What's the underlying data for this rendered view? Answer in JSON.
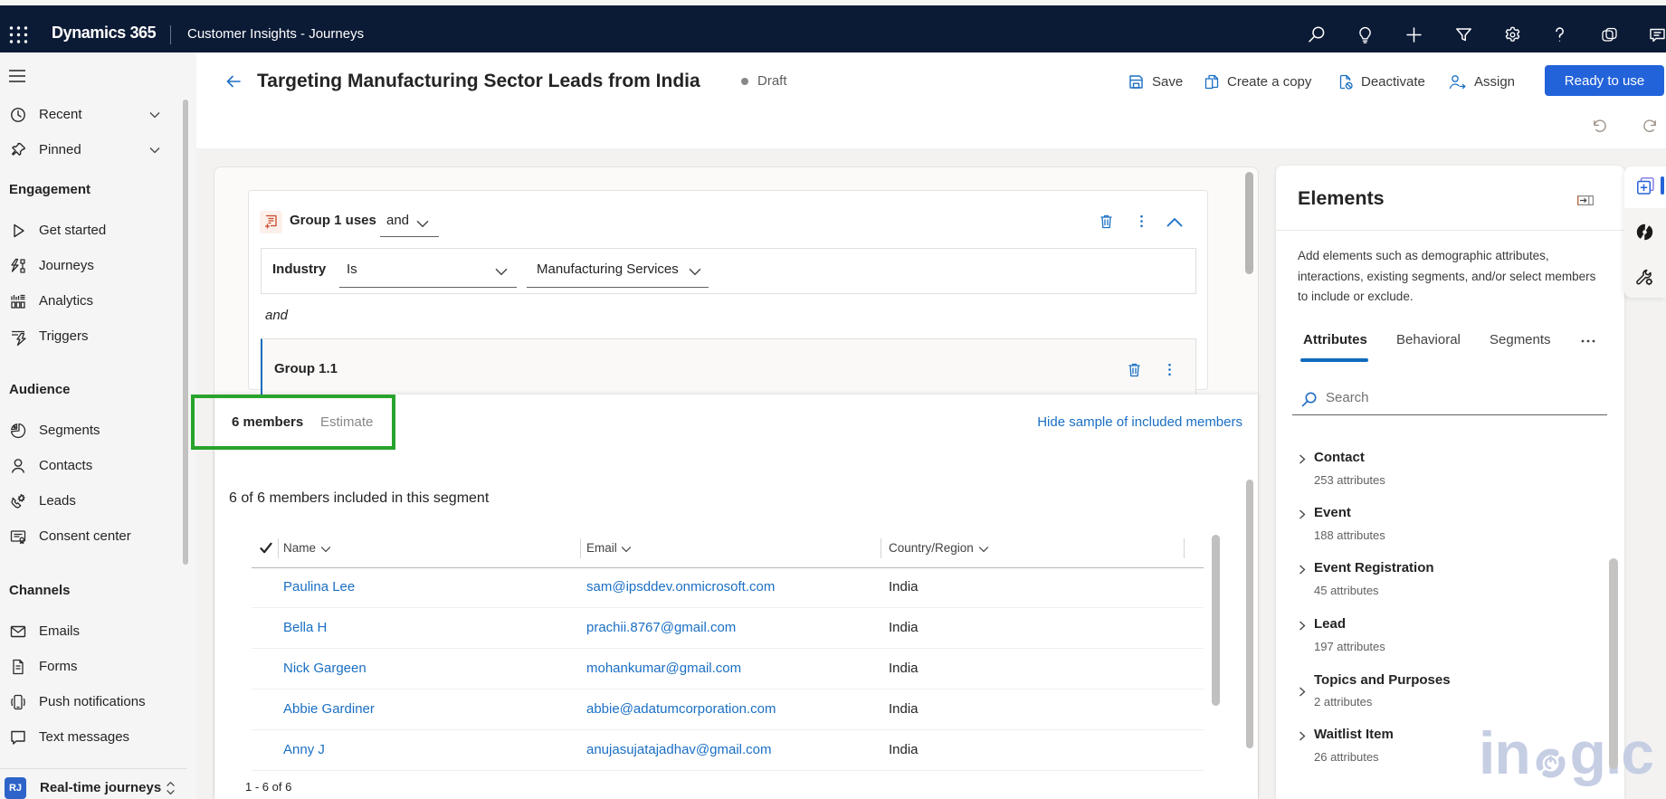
{
  "topbar": {
    "app_name": "Dynamics 365",
    "section_name": "Customer Insights - Journeys"
  },
  "header": {
    "title": "Targeting Manufacturing Sector Leads from India",
    "status": "Draft",
    "save_label": "Save",
    "create_copy_label": "Create a copy",
    "deactivate_label": "Deactivate",
    "assign_label": "Assign",
    "primary_label": "Ready to use"
  },
  "sidebar": {
    "recent_label": "Recent",
    "pinned_label": "Pinned",
    "sections": [
      {
        "title": "Engagement",
        "items": [
          {
            "label": "Get started"
          },
          {
            "label": "Journeys"
          },
          {
            "label": "Analytics"
          },
          {
            "label": "Triggers"
          }
        ]
      },
      {
        "title": "Audience",
        "items": [
          {
            "label": "Segments"
          },
          {
            "label": "Contacts"
          },
          {
            "label": "Leads"
          },
          {
            "label": "Consent center"
          }
        ]
      },
      {
        "title": "Channels",
        "items": [
          {
            "label": "Emails"
          },
          {
            "label": "Forms"
          },
          {
            "label": "Push notifications"
          },
          {
            "label": "Text messages"
          }
        ]
      }
    ],
    "area_badge": "RJ",
    "area_name": "Real-time journeys"
  },
  "builder": {
    "group_label": "Group 1 uses",
    "group_operator": "and",
    "condition_attribute": "Industry",
    "condition_operator": "Is",
    "condition_value": "Manufacturing Services",
    "connector": "and",
    "subgroup_label": "Group 1.1"
  },
  "members": {
    "members_tab": "6 members",
    "estimate_tab": "Estimate",
    "hide_link": "Hide sample of included members",
    "summary": "6 of 6 members included in this segment",
    "columns": [
      "Name",
      "Email",
      "Country/Region"
    ],
    "rows": [
      {
        "name": "Paulina Lee",
        "email": "sam@ipsddev.onmicrosoft.com",
        "country": "India"
      },
      {
        "name": "Bella H",
        "email": "prachii.8767@gmail.com",
        "country": "India"
      },
      {
        "name": "Nick Gargeen",
        "email": "mohankumar@gmail.com",
        "country": "India"
      },
      {
        "name": "Abbie Gardiner",
        "email": "abbie@adatumcorporation.com",
        "country": "India"
      },
      {
        "name": "Anny J",
        "email": "anujasujatajadhav@gmail.com",
        "country": "India"
      }
    ],
    "pagination": "1 - 6 of 6"
  },
  "elements_panel": {
    "title": "Elements",
    "description": "Add elements such as demographic attributes, interactions, existing segments, and/or select members to include or exclude.",
    "tabs": [
      "Attributes",
      "Behavioral",
      "Segments"
    ],
    "search_placeholder": "Search",
    "entities": [
      {
        "name": "Contact",
        "count": "253 attributes"
      },
      {
        "name": "Event",
        "count": "188 attributes"
      },
      {
        "name": "Event Registration",
        "count": "45 attributes"
      },
      {
        "name": "Lead",
        "count": "197 attributes"
      },
      {
        "name": "Topics and Purposes",
        "count": "2 attributes"
      },
      {
        "name": "Waitlist Item",
        "count": "26 attributes"
      }
    ]
  },
  "watermark": {
    "part1": "in",
    "part2": "gic"
  },
  "colors": {
    "topbar": "#0b1a35",
    "primary_button": "#2363da",
    "accent_blue": "#0f6cbd",
    "link_blue": "#1a6fc4",
    "annotation_green": "#28a32c"
  }
}
